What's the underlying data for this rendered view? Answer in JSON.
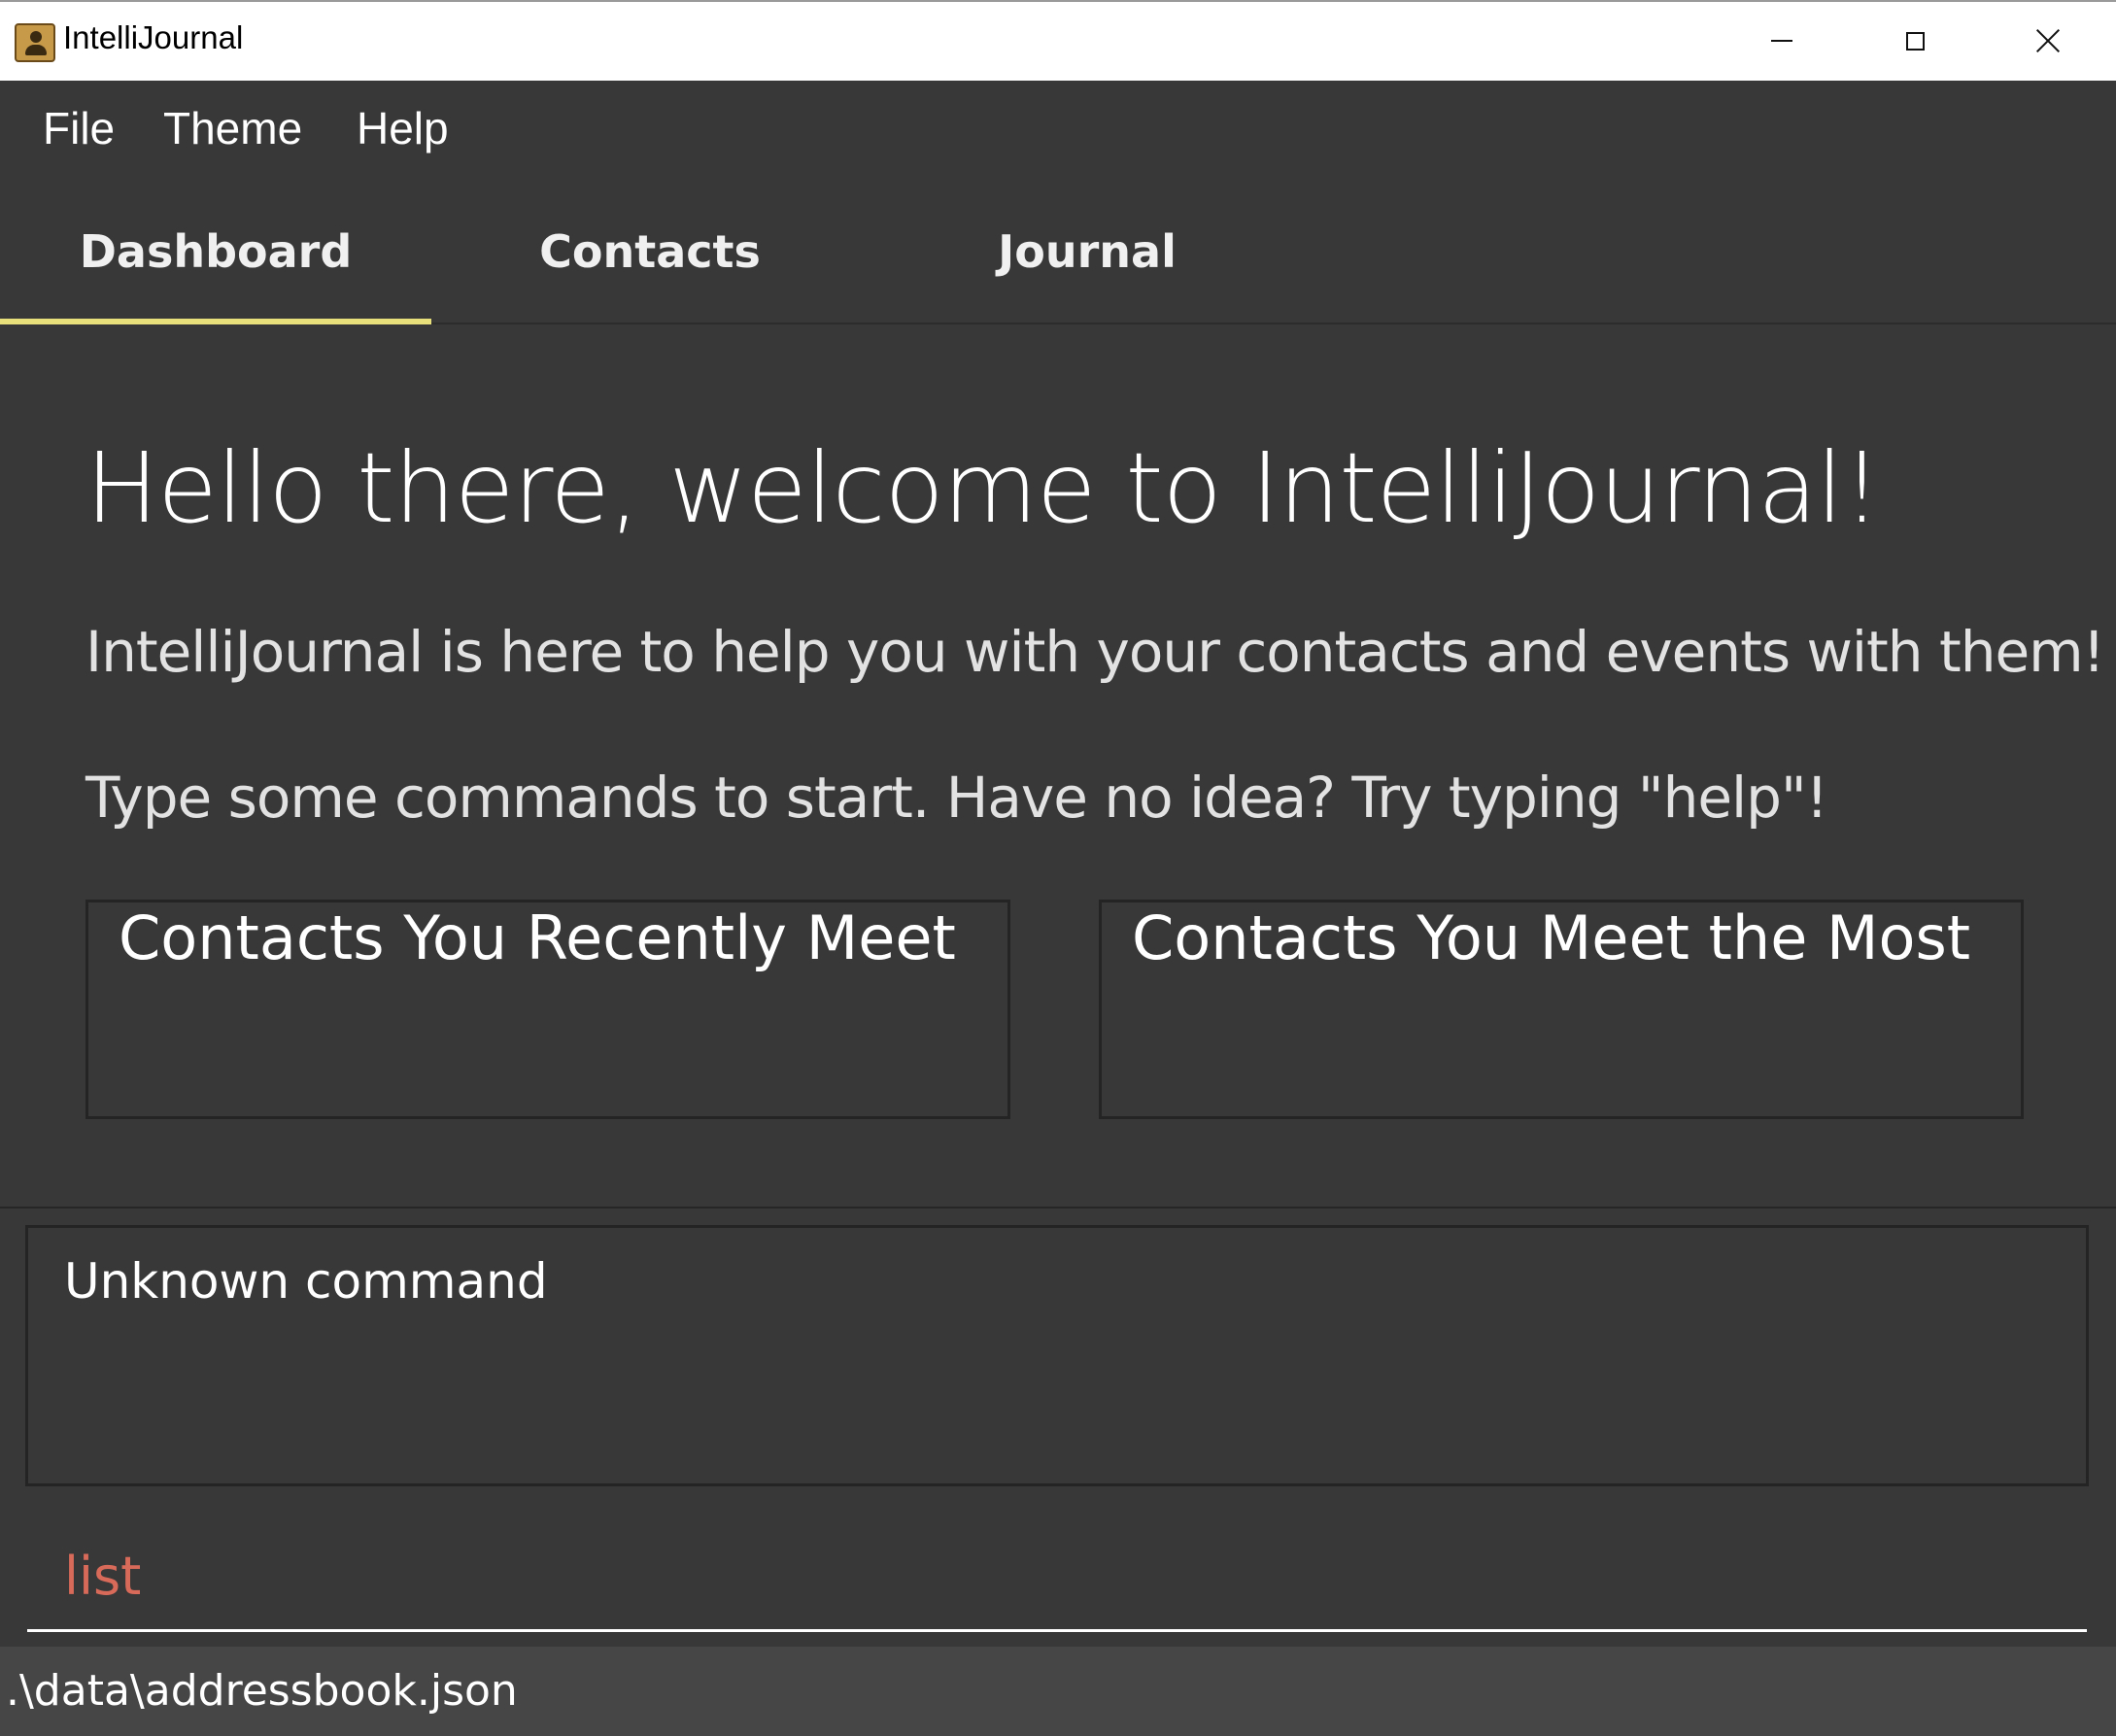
{
  "window": {
    "title": "IntelliJournal",
    "icons": {
      "app": "contact-book-icon",
      "minimize": "minimize-icon",
      "maximize": "maximize-icon",
      "close": "close-icon"
    }
  },
  "menu": {
    "items": [
      {
        "label": "File"
      },
      {
        "label": "Theme"
      },
      {
        "label": "Help"
      }
    ]
  },
  "tabs": {
    "active": "Dashboard",
    "active_color": "#e8e07a",
    "items": [
      {
        "label": "Dashboard"
      },
      {
        "label": "Contacts"
      },
      {
        "label": "Journal"
      }
    ]
  },
  "dashboard": {
    "greeting": "Hello there, welcome to IntelliJournal!",
    "intro": "IntelliJournal is here to help you with your contacts and events with them!",
    "hint": "Type some commands to start. Have no idea? Try typing \"help\"!",
    "panels": {
      "recent_title": "Contacts You Recently Meet",
      "most_title": "Contacts You Meet the Most"
    }
  },
  "result": {
    "message": "Unknown command"
  },
  "command": {
    "value": "list",
    "color": "#d86a5a"
  },
  "status": {
    "file_path": ".\\data\\addressbook.json"
  }
}
